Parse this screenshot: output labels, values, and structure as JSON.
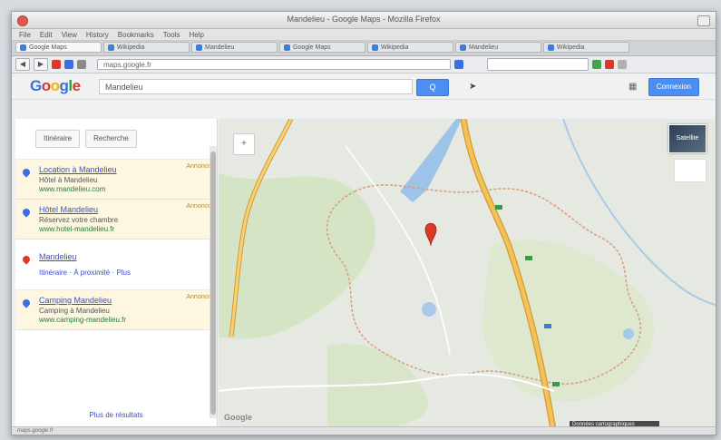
{
  "window": {
    "title": "Mandelieu - Google Maps - Mozilla Firefox"
  },
  "menubar": {
    "items": [
      "File",
      "Edit",
      "View",
      "History",
      "Bookmarks",
      "Tools",
      "Help"
    ]
  },
  "tabs": [
    {
      "label": "Google Maps",
      "active": true
    },
    {
      "label": "Wikipedia"
    },
    {
      "label": "Mandelieu"
    },
    {
      "label": "Google Maps"
    },
    {
      "label": "Wikipedia"
    },
    {
      "label": "Mandelieu"
    },
    {
      "label": "Wikipedia"
    }
  ],
  "toolbar": {
    "back": "◀",
    "forward": "▶",
    "url": "maps.google.fr"
  },
  "google": {
    "logo": [
      "G",
      "o",
      "o",
      "g",
      "l",
      "e"
    ],
    "search_value": "Mandelieu",
    "search_button": "Q",
    "signin_label": "Connexion"
  },
  "left_panel": {
    "buttons": [
      "Itinéraire",
      "Recherche"
    ],
    "results": [
      {
        "type": "ad",
        "ad_label": "Annonce",
        "title": "Location à Mandelieu",
        "lines": [
          "Hôtel à Mandelieu",
          "www.mandelieu.com"
        ]
      },
      {
        "type": "ad",
        "ad_label": "Annonce",
        "title": "Hôtel Mandelieu",
        "lines": [
          "Réservez votre chambre",
          "www.hotel-mandelieu.fr"
        ]
      },
      {
        "type": "place",
        "title": "Mandelieu",
        "lines": [
          "Itinéraire · À proximité · Plus"
        ]
      },
      {
        "type": "ad",
        "ad_label": "Annonce",
        "title": "Camping Mandelieu",
        "lines": [
          "Camping à Mandelieu",
          "www.camping-mandelieu.fr"
        ]
      }
    ],
    "more": "Plus de résultats"
  },
  "map": {
    "control_label": "+",
    "satellite_label": "Satellite",
    "attribution": "Données cartographiques",
    "logo": "Google",
    "status": "maps.google.fr",
    "colors": {
      "road_main": "#f2c25c",
      "road_border": "#d79a2a",
      "boundary": "#d99c7a",
      "water": "#9ec3e8",
      "forest": "#cfe0bd",
      "land": "#e6e9e1",
      "marker": "#d8392b"
    }
  }
}
